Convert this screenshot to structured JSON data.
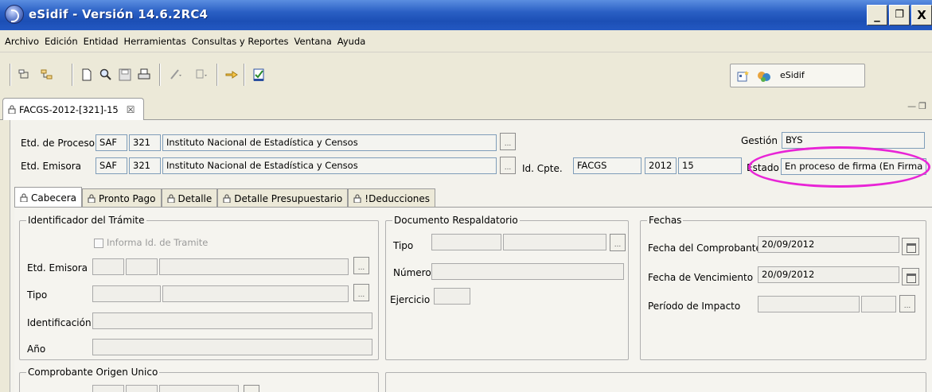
{
  "window": {
    "title": "eSidif - Versión 14.6.2RC4",
    "buttons": {
      "minimize": "_",
      "restore": "Ɖ",
      "close": "X"
    }
  },
  "menu": [
    "Archivo",
    "Edición",
    "Entidad",
    "Herramientas",
    "Consultas y Reportes",
    "Ventana",
    "Ayuda"
  ],
  "perspective": {
    "label": "eSidif"
  },
  "editor_tab": {
    "label": "FACGS-2012-[321]-15",
    "close": "☒"
  },
  "header": {
    "etd_proceso": {
      "label": "Etd. de Proceso",
      "code": "SAF",
      "number": "321",
      "name": "Instituto Nacional de Estadística y Censos"
    },
    "etd_emisora": {
      "label": "Etd. Emisora",
      "code": "SAF",
      "number": "321",
      "name": "Instituto Nacional de Estadística y Censos"
    },
    "gestion": {
      "label": "Gestión",
      "value": "BYS"
    },
    "id_cpte": {
      "label": "Id. Cpte.",
      "type": "FACGS",
      "year": "2012",
      "number": "15"
    },
    "estado": {
      "label": "Estado",
      "value": "En proceso de firma (En Firma"
    },
    "dots": "..."
  },
  "subtabs": [
    "Cabecera",
    "Pronto Pago",
    "Detalle",
    "Detalle Presupuestario",
    "!Deducciones"
  ],
  "identificador": {
    "title": "Identificador del Trámite",
    "checkbox_label": "Informa Id. de Tramite",
    "etd_emisora": "Etd. Emisora",
    "tipo": "Tipo",
    "identificacion": "Identificación",
    "anio": "Año"
  },
  "documento": {
    "title": "Documento Respaldatorio",
    "tipo": "Tipo",
    "numero": "Número",
    "ejercicio": "Ejercicio"
  },
  "fechas": {
    "title": "Fechas",
    "comprobante": {
      "label": "Fecha del Comprobante",
      "value": "20/09/2012"
    },
    "vencimiento": {
      "label": "Fecha de Vencimiento",
      "value": "20/09/2012"
    },
    "periodo": {
      "label": "Período de Impacto"
    }
  },
  "comprobante_origen": {
    "title": "Comprobante Origen Unico"
  }
}
